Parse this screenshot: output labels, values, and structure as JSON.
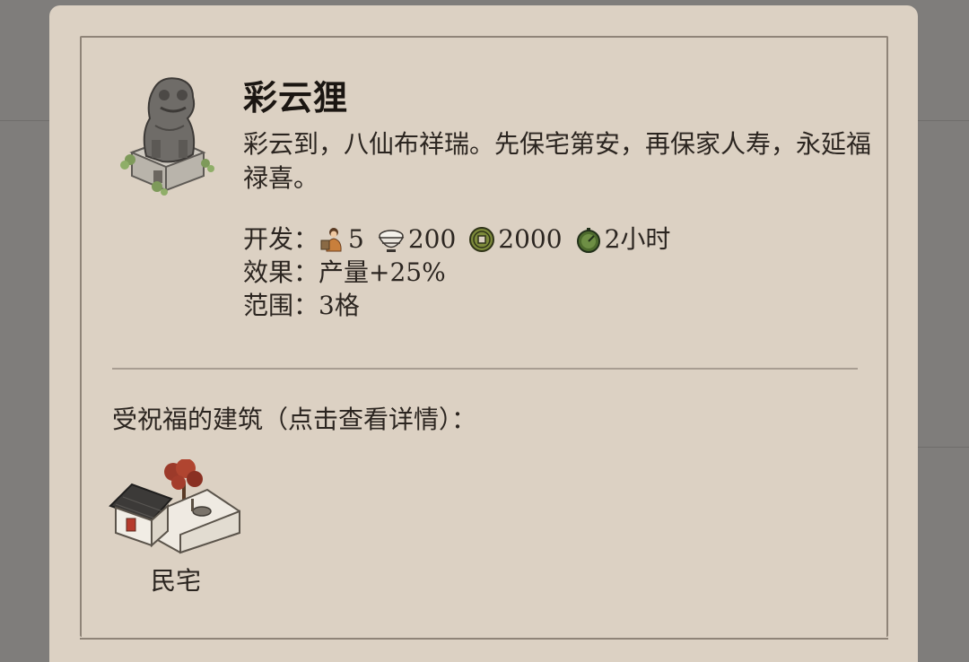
{
  "item": {
    "name": "彩云狸",
    "icon": "stone-lion-statue-icon",
    "description": "彩云到，八仙布祥瑞。先保宅第安，再保家人寿，永延福禄喜。"
  },
  "stats": {
    "develop_label": "开发：",
    "costs": [
      {
        "icon": "worker-icon",
        "value": "5"
      },
      {
        "icon": "rice-bowl-icon",
        "value": "200"
      },
      {
        "icon": "copper-coin-icon",
        "value": "2000"
      },
      {
        "icon": "timer-icon",
        "value": "2小时"
      }
    ],
    "effect_label": "效果：",
    "effect_value": "产量+25%",
    "range_label": "范围：",
    "range_value": "3格"
  },
  "blessed": {
    "label": "受祝福的建筑（点击查看详情）：",
    "buildings": [
      {
        "name": "民宅",
        "icon": "residence-house-icon"
      }
    ]
  }
}
